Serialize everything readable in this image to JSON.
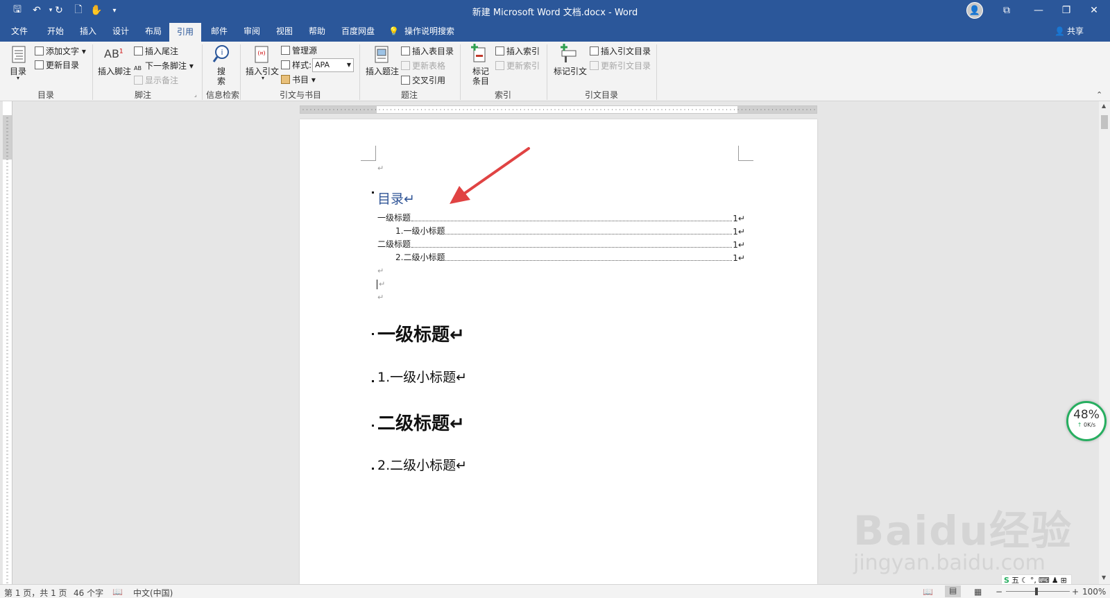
{
  "window": {
    "title": "新建 Microsoft Word 文档.docx  -  Word",
    "quick_access": [
      "save-icon",
      "undo-icon",
      "redo-icon",
      "print-preview-icon",
      "touch-mode-icon",
      "customize-icon"
    ],
    "controls": [
      "ribbon-display-icon",
      "minimize-icon",
      "restore-icon",
      "close-icon"
    ]
  },
  "tabs": [
    {
      "label": "文件"
    },
    {
      "label": "开始"
    },
    {
      "label": "插入"
    },
    {
      "label": "设计"
    },
    {
      "label": "布局"
    },
    {
      "label": "引用",
      "active": true
    },
    {
      "label": "邮件"
    },
    {
      "label": "审阅"
    },
    {
      "label": "视图"
    },
    {
      "label": "帮助"
    },
    {
      "label": "百度网盘"
    }
  ],
  "tell_me": "操作说明搜索",
  "share": "共享",
  "ribbon": {
    "toc": {
      "big": "目录",
      "add_text": "添加文字",
      "update_toc": "更新目录",
      "label": "目录"
    },
    "footnote": {
      "big": "插入脚注",
      "insert_endnote": "插入尾注",
      "next_footnote": "下一条脚注",
      "show_notes": "显示备注",
      "label": "脚注"
    },
    "research": {
      "big_line1": "搜",
      "big_line2": "索",
      "label": "信息检索"
    },
    "citations": {
      "big": "插入引文",
      "manage_sources": "管理源",
      "style_label": "样式:",
      "style_value": "APA",
      "bibliography": "书目",
      "label": "引文与书目"
    },
    "captions": {
      "big": "插入题注",
      "insert_table_of_figures": "插入表目录",
      "update_table": "更新表格",
      "cross_reference": "交叉引用",
      "label": "题注"
    },
    "index": {
      "big_line1": "标记",
      "big_line2": "条目",
      "insert_index": "插入索引",
      "update_index": "更新索引",
      "label": "索引"
    },
    "toa": {
      "big": "标记引文",
      "insert_toa": "插入引文目录",
      "update_toa": "更新引文目录",
      "label": "引文目录"
    }
  },
  "document": {
    "toc_heading": "目录↵",
    "toc_entries": [
      {
        "text": "一级标题",
        "page": "1↵",
        "level": 1
      },
      {
        "text": "1.一级小标题",
        "page": "1↵",
        "level": 2
      },
      {
        "text": "二级标题",
        "page": "1↵",
        "level": 1
      },
      {
        "text": "2.二级小标题",
        "page": "1↵",
        "level": 2
      }
    ],
    "para_mark": "↵",
    "headings": [
      {
        "text": "一级标题↵",
        "style": "h1"
      },
      {
        "text": "1.一级小标题↵",
        "style": "h2"
      },
      {
        "text": "二级标题↵",
        "style": "h1"
      },
      {
        "text": "2.二级小标题↵",
        "style": "h2"
      }
    ]
  },
  "speed_widget": {
    "percent": "48%",
    "rate": "0K/s"
  },
  "watermark": {
    "brand": "Baidu经验",
    "url": "jingyan.baidu.com"
  },
  "ime": {
    "label": "五"
  },
  "statusbar": {
    "page": "第 1 页，共 1 页",
    "words": "46 个字",
    "language": "中文(中国)",
    "zoom": "100%",
    "zoom_minus": "−",
    "zoom_plus": "+"
  },
  "colors": {
    "accent": "#2b579a",
    "heading_blue": "#2f5496",
    "arrow": "#e04343"
  }
}
